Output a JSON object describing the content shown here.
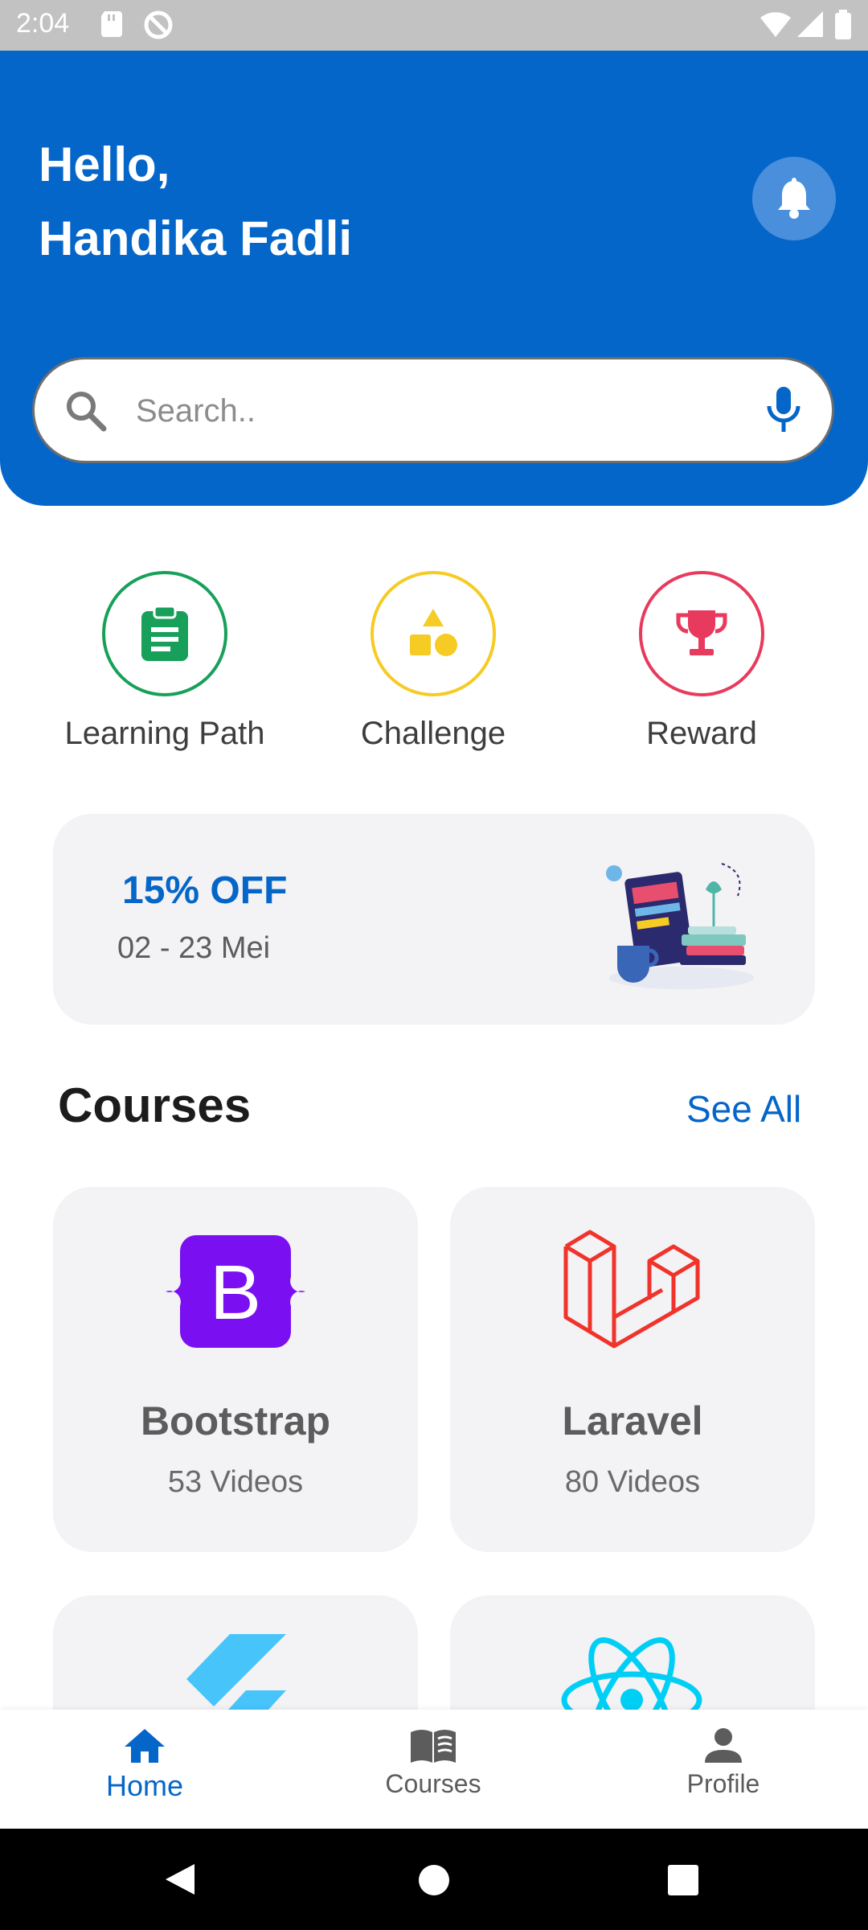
{
  "status_bar": {
    "time": "2:04"
  },
  "header": {
    "greeting_line1": "Hello,",
    "greeting_line2": "Handika Fadli"
  },
  "search": {
    "placeholder": "Search..",
    "value": ""
  },
  "categories": [
    {
      "label": "Learning Path",
      "icon": "clipboard-icon",
      "color": "#18a05a"
    },
    {
      "label": "Challenge",
      "icon": "shapes-icon",
      "color": "#f5cb24"
    },
    {
      "label": "Reward",
      "icon": "trophy-icon",
      "color": "#e83a5c"
    }
  ],
  "promo": {
    "title": "15% OFF",
    "date": "02 - 23 Mei"
  },
  "courses_section": {
    "title": "Courses",
    "see_all": "See All"
  },
  "courses": [
    {
      "name": "Bootstrap",
      "videos": "53 Videos",
      "icon": "bootstrap-logo-icon",
      "color": "#7a10f2"
    },
    {
      "name": "Laravel",
      "videos": "80 Videos",
      "icon": "laravel-logo-icon",
      "color": "#f0332b"
    },
    {
      "name": "",
      "videos": "",
      "icon": "flutter-logo-icon",
      "color": "#47c5fb"
    },
    {
      "name": "",
      "videos": "",
      "icon": "react-logo-icon",
      "color": "#00cff5"
    }
  ],
  "bottom_nav": [
    {
      "label": "Home",
      "icon": "home-icon",
      "active": true
    },
    {
      "label": "Courses",
      "icon": "book-icon",
      "active": false
    },
    {
      "label": "Profile",
      "icon": "person-icon",
      "active": false
    }
  ],
  "colors": {
    "primary": "#0566c9",
    "card_bg": "#f3f2f4"
  }
}
